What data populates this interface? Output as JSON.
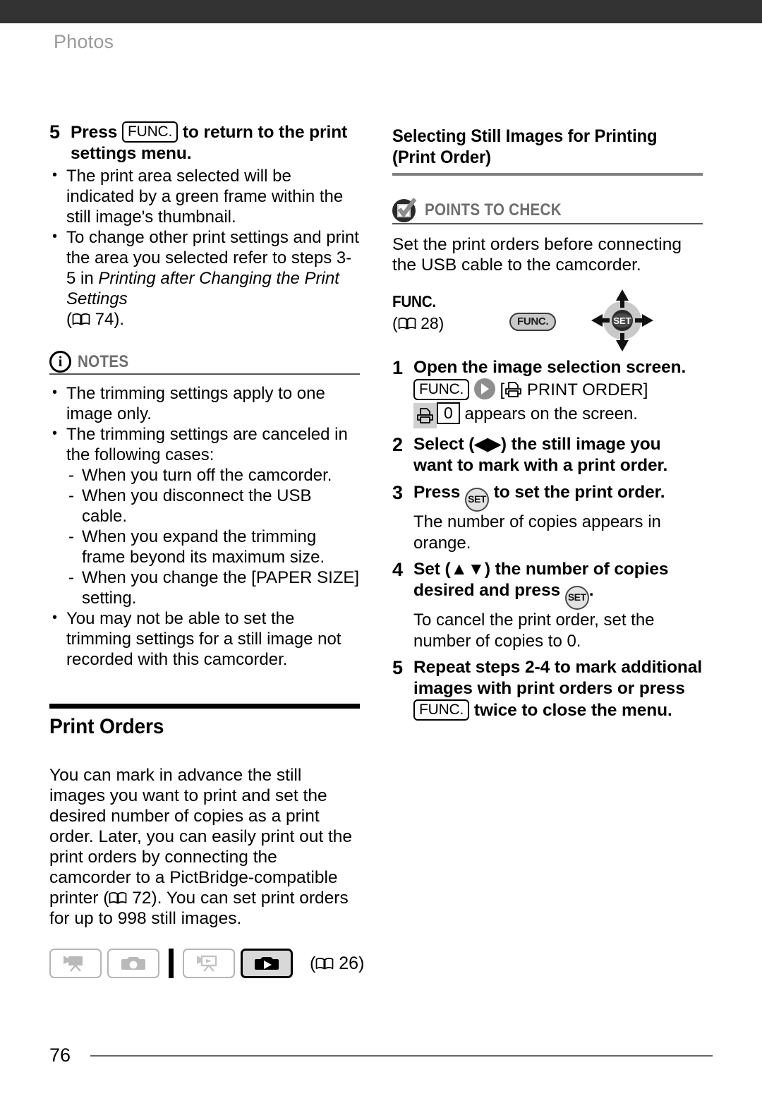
{
  "running_head": "Photos",
  "page_number": "76",
  "colors": {
    "topbar": "#333333",
    "running_head": "#9a9a9a",
    "rule_gray": "#808080",
    "label_gray": "#6e6e6e",
    "active_mode_bg": "#d8d8d8"
  },
  "left_column": {
    "step5": {
      "number": "5",
      "title_before": "Press",
      "chip": "FUNC.",
      "title_after": "to return to the print settings menu.",
      "bullets": [
        "The print area selected will be indicated by a green frame within the still image's thumbnail.",
        "To change other print settings and print the area you selected refer to steps 3-5 in "
      ],
      "bullet2_italic": "Printing after Changing the Print Settings",
      "bullet2_ref_open": "(",
      "bullet2_ref_page": "74",
      "bullet2_ref_close": ")."
    },
    "notes": {
      "icon": "info-circle-icon",
      "label": "NOTES",
      "items": [
        "The trimming settings apply to one image only.",
        "The trimming settings are canceled in the following cases:",
        "You may not be able to set the trimming settings for a still image not recorded with this camcorder."
      ],
      "sub_items": [
        "When you turn off the camcorder.",
        "When you disconnect the USB cable.",
        "When you expand the trimming frame beyond its maximum size.",
        "When you change the [PAPER SIZE] setting."
      ]
    },
    "print_orders": {
      "heading": "Print Orders",
      "paragraph_a": "You can mark in advance the still images you want to print and set the desired number of copies as a print order. Later, you can easily print out the print orders by connecting the camcorder to a PictBridge-compatible printer (",
      "paragraph_ref_page": "72",
      "paragraph_b": "). You can set print orders for up to 998 still images."
    },
    "mode_row": {
      "modes": [
        {
          "name": "camera-movie-record-mode",
          "active": false
        },
        {
          "name": "camera-photo-record-mode",
          "active": false
        },
        {
          "name": "play-movie-mode",
          "active": false
        },
        {
          "name": "play-photo-mode",
          "active": true
        }
      ],
      "ref_open": "(",
      "ref_page": "26",
      "ref_close": ")"
    }
  },
  "right_column": {
    "heading_line1": "Selecting Still Images for Printing",
    "heading_line2": "(Print Order)",
    "points_to_check": {
      "icon": "checkbox-check-icon",
      "label": "POINTS TO CHECK",
      "text": "Set the print orders before connecting the USB cable to the camcorder."
    },
    "func_block": {
      "title": "FUNC.",
      "ref_open": "(",
      "ref_page": "28",
      "ref_close": ")",
      "button_label": "FUNC.",
      "joystick_center_label": "SET"
    },
    "steps": [
      {
        "number": "1",
        "title": "Open the image selection screen.",
        "seq_chip": "FUNC.",
        "seq_bracket_open": "[",
        "seq_menu_label": "PRINT ORDER",
        "seq_bracket_close": "]",
        "seq_value": "0",
        "seq_tail": "appears on the screen."
      },
      {
        "number": "2",
        "title_a": "Select (",
        "title_arrows": "◀▶",
        "title_b": ") the still image you want to mark with a print order."
      },
      {
        "number": "3",
        "title_a": "Press",
        "set_label": "SET",
        "title_b": "to set the print order.",
        "sub": "The number of copies appears in orange."
      },
      {
        "number": "4",
        "title_a": "Set (",
        "title_arrows": "▲▼",
        "title_b": ") the number of copies desired and press",
        "set_label": "SET",
        "title_c": ".",
        "sub": "To cancel the print order, set the number of copies to 0."
      },
      {
        "number": "5",
        "title_a": "Repeat steps 2-4 to mark additional images with print orders or press",
        "chip": "FUNC.",
        "title_b": "twice to close the menu."
      }
    ]
  }
}
